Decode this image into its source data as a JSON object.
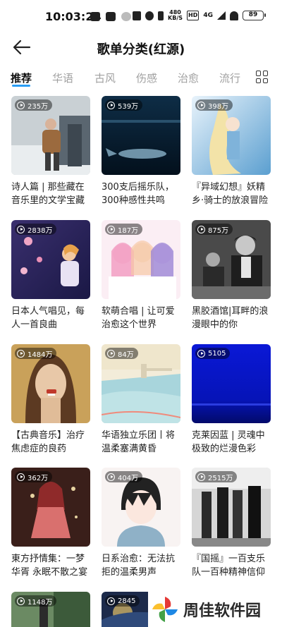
{
  "status_bar": {
    "time": "10:03:24",
    "net_speed_top": "480",
    "net_speed_bottom": "KB/S",
    "network": "HD",
    "signal": "4G",
    "battery": "89"
  },
  "header": {
    "title": "歌单分类(红源)"
  },
  "tabs": [
    {
      "label": "推荐"
    },
    {
      "label": "华语"
    },
    {
      "label": "古风"
    },
    {
      "label": "伤感"
    },
    {
      "label": "治愈"
    },
    {
      "label": "流行"
    }
  ],
  "playlists": [
    {
      "count": "235万",
      "title": "诗人篇 | 那些藏在音乐里的文学宝藏"
    },
    {
      "count": "539万",
      "title": "300支后摇乐队，300种感性共鸣"
    },
    {
      "count": "398万",
      "title": "『异域幻想』妖精乡·骑士的放浪冒险谭"
    },
    {
      "count": "2838万",
      "title": "日本人气唱见，每人一首良曲"
    },
    {
      "count": "187万",
      "title": "软萌合唱 | 让可爱治愈这个世界"
    },
    {
      "count": "875万",
      "title": "黑胶酒馆|耳畔的浪漫眼中的你"
    },
    {
      "count": "1484万",
      "title": "【古典音乐】治疗焦虑症的良药"
    },
    {
      "count": "84万",
      "title": "华语独立乐团丨将温柔塞满黄昏"
    },
    {
      "count": "5105",
      "title": "克莱因蓝 | 灵魂中极致的烂漫色彩"
    },
    {
      "count": "362万",
      "title": "東方抒情集：一梦华胥 永眠不散之宴"
    },
    {
      "count": "404万",
      "title": "日系治愈：无法抗拒的温柔男声"
    },
    {
      "count": "2515万",
      "title": "『国摇』一百支乐队一百种精神信仰"
    },
    {
      "count": "1148万",
      "title": ""
    },
    {
      "count": "2845",
      "title": ""
    }
  ],
  "watermark": {
    "text": "周佳软件园"
  },
  "colors": {
    "accent": "#2a9df4",
    "inactive_tab": "#a0a0a0"
  }
}
